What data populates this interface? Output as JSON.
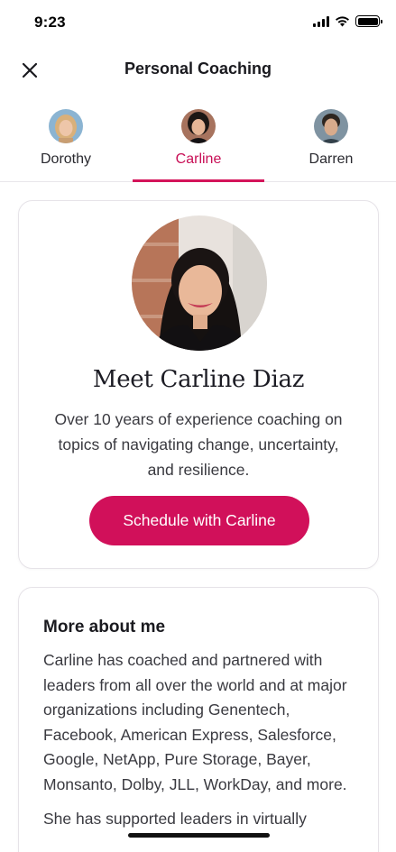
{
  "status_bar": {
    "time": "9:23",
    "icons": [
      "cellular-signal-icon",
      "wifi-icon",
      "battery-icon"
    ]
  },
  "header": {
    "title": "Personal Coaching",
    "close_icon": "close-icon"
  },
  "coaches": {
    "active_index": 1,
    "accent_color": "#d1105a",
    "tabs": [
      {
        "label": "Dorothy"
      },
      {
        "label": "Carline"
      },
      {
        "label": "Darren"
      }
    ]
  },
  "profile": {
    "title": "Meet Carline Diaz",
    "summary": "Over 10 years of experience coaching on topics of navigating change, uncertainty, and resilience.",
    "schedule_label": "Schedule with Carline"
  },
  "about": {
    "title": "More about me",
    "paragraphs": [
      "Carline has coached and partnered with leaders from all over the world and at major organizations including Genentech, Facebook, American Express, Salesforce, Google, NetApp, Pure Storage, Bayer, Monsanto, Dolby, JLL, WorkDay, and more.",
      "She has supported leaders in virtually"
    ]
  }
}
